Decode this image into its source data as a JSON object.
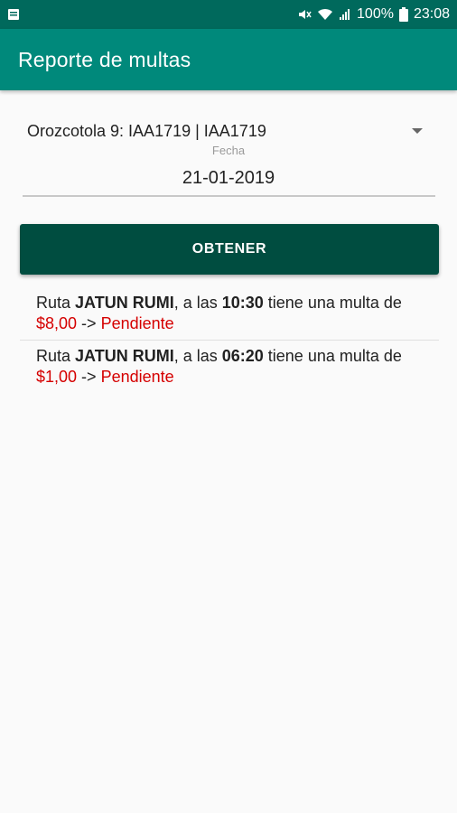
{
  "status_bar": {
    "battery_percent": "100%",
    "time": "23:08"
  },
  "app_bar": {
    "title": "Reporte de multas"
  },
  "form": {
    "vehicle_selected": "Orozcotola 9: IAA1719 | IAA1719",
    "date_label": "Fecha",
    "date_value": "21-01-2019",
    "button_label": "OBTENER"
  },
  "results": [
    {
      "prefix": "Ruta ",
      "route": "JATUN RUMI",
      "mid": ", a las ",
      "time": "10:30",
      "suffix": " tiene una multa de ",
      "amount": "$8,00",
      "arrow": " -> ",
      "status": "Pendiente"
    },
    {
      "prefix": "Ruta ",
      "route": "JATUN RUMI",
      "mid": ", a las ",
      "time": "06:20",
      "suffix": " tiene una multa de ",
      "amount": "$1,00",
      "arrow": " -> ",
      "status": "Pendiente"
    }
  ],
  "colors": {
    "status_bar": "#00695c",
    "app_bar": "#00897b",
    "button": "#004d40",
    "accent_red": "#d50000"
  }
}
